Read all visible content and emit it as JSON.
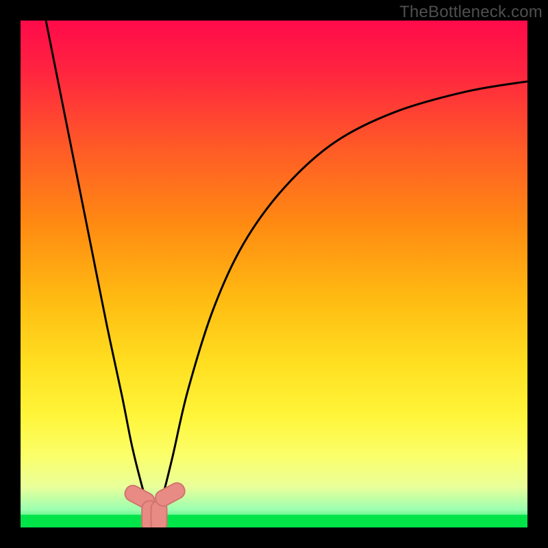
{
  "watermark": "TheBottleneck.com",
  "colors": {
    "frame": "#000000",
    "curve": "#000000",
    "green_band": "#00e44a",
    "gradient_stops": [
      {
        "offset": 0.0,
        "color": "#ff0a4a"
      },
      {
        "offset": 0.1,
        "color": "#ff2440"
      },
      {
        "offset": 0.25,
        "color": "#ff5a27"
      },
      {
        "offset": 0.4,
        "color": "#ff8a12"
      },
      {
        "offset": 0.55,
        "color": "#ffbb12"
      },
      {
        "offset": 0.68,
        "color": "#ffe021"
      },
      {
        "offset": 0.78,
        "color": "#fff53a"
      },
      {
        "offset": 0.86,
        "color": "#fbff6b"
      },
      {
        "offset": 0.92,
        "color": "#e9ff9a"
      },
      {
        "offset": 0.965,
        "color": "#9affb0"
      },
      {
        "offset": 1.0,
        "color": "#00e44a"
      }
    ],
    "marker_fill": "#e88b85",
    "marker_stroke": "#d2736d"
  },
  "chart_data": {
    "type": "line",
    "title": "",
    "xlabel": "",
    "ylabel": "",
    "xlim": [
      0,
      100
    ],
    "ylim": [
      0,
      100
    ],
    "x_optimum": 26,
    "curve_minimum_y": 2,
    "series": [
      {
        "name": "bottleneck-curve",
        "x": [
          5,
          8,
          11,
          14,
          17,
          20,
          22,
          24,
          25.5,
          26,
          27,
          28,
          30,
          33,
          38,
          44,
          52,
          62,
          74,
          88,
          100
        ],
        "y": [
          100,
          85,
          70,
          55,
          40,
          26,
          16,
          8,
          3,
          2,
          3,
          6,
          14,
          27,
          43,
          56,
          67,
          76,
          82,
          86,
          88
        ]
      }
    ],
    "markers": [
      {
        "x": 23.5,
        "y": 6.0,
        "angle": -62
      },
      {
        "x": 25.5,
        "y": 2.2,
        "angle": 0
      },
      {
        "x": 27.3,
        "y": 2.2,
        "angle": 0
      },
      {
        "x": 29.5,
        "y": 6.5,
        "angle": 62
      }
    ],
    "annotations": []
  }
}
